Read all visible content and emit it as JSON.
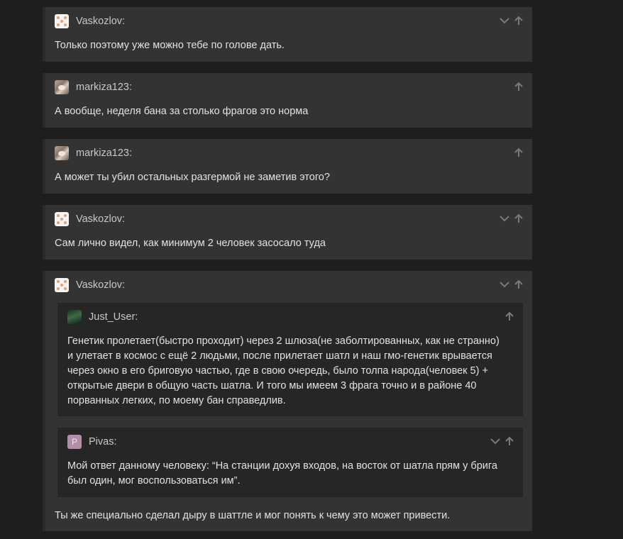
{
  "comments": [
    {
      "author": "Vaskozlov:",
      "avatar": "dots-avatar-icon",
      "text": "Только поэтому уже можно тебе по голове дать."
    },
    {
      "author": "markiza123:",
      "avatar": "cat-avatar-icon",
      "text": "А вообще, неделя бана за столько фрагов это норма"
    },
    {
      "author": "markiza123:",
      "avatar": "cat-avatar-icon",
      "text": "А может ты убил остальных разгермой не заметив этого?"
    },
    {
      "author": "Vaskozlov:",
      "avatar": "dots-avatar-icon",
      "text": "Сам лично видел, как минимум 2 человек засосало туда"
    },
    {
      "author": "Vaskozlov:",
      "avatar": "dots-avatar-icon",
      "text": "Ты же специально сделал дыру в шаттле и мог понять к чему это может привести.",
      "quotes": [
        {
          "author": "Just_User:",
          "avatar": "user-avatar-icon",
          "lines": [
            "Генетик пролетает(быстро проходит) через 2 шлюза(не заболтированных, как не странно)",
            "и улетает в космос с ещё 2 людьми, после прилетает шатл и наш гмо-генетик врывается",
            "через окно в его бриговую частью, где в свою очередь, было толпа народа(человек 5) +",
            "открытые двери в общую часть шатла. И того мы имеем 3 фрага точно и в районе 40",
            "порванных легких, по моему бан справедлив."
          ]
        },
        {
          "author": "Pivas:",
          "avatar_letter": "P",
          "lines": [
            "Мой ответ данному человеку: “На станции дохуя входов, на восток от шатла прям у брига",
            "был один, мог воспользоваться им”."
          ]
        }
      ]
    }
  ],
  "colors": {
    "background": "#1e1e1e",
    "card": "#333333",
    "quote": "#262626",
    "icon": "#7a7a7a"
  },
  "icons": {
    "expand": "chevron-down-icon",
    "up": "arrow-up-icon"
  }
}
